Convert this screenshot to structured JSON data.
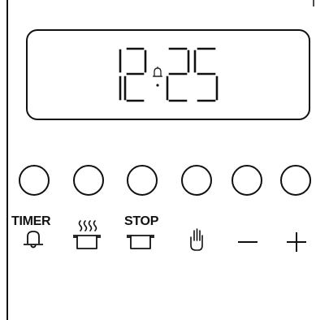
{
  "display": {
    "time": "12:25",
    "alarm_indicator": "bell-icon"
  },
  "controls": {
    "buttons": [
      {
        "id": "timer",
        "label": "TIMER",
        "icon": "bell-icon"
      },
      {
        "id": "cook-steam",
        "label": "",
        "icon": "pot-with-steam-icon"
      },
      {
        "id": "stop",
        "label": "STOP",
        "icon": "pot-icon"
      },
      {
        "id": "manual",
        "label": "",
        "icon": "hand-icon"
      },
      {
        "id": "minus",
        "label": "",
        "icon": "minus-icon"
      },
      {
        "id": "plus",
        "label": "",
        "icon": "plus-icon"
      }
    ]
  },
  "colors": {
    "line": "#111111",
    "background": "#ffffff"
  }
}
